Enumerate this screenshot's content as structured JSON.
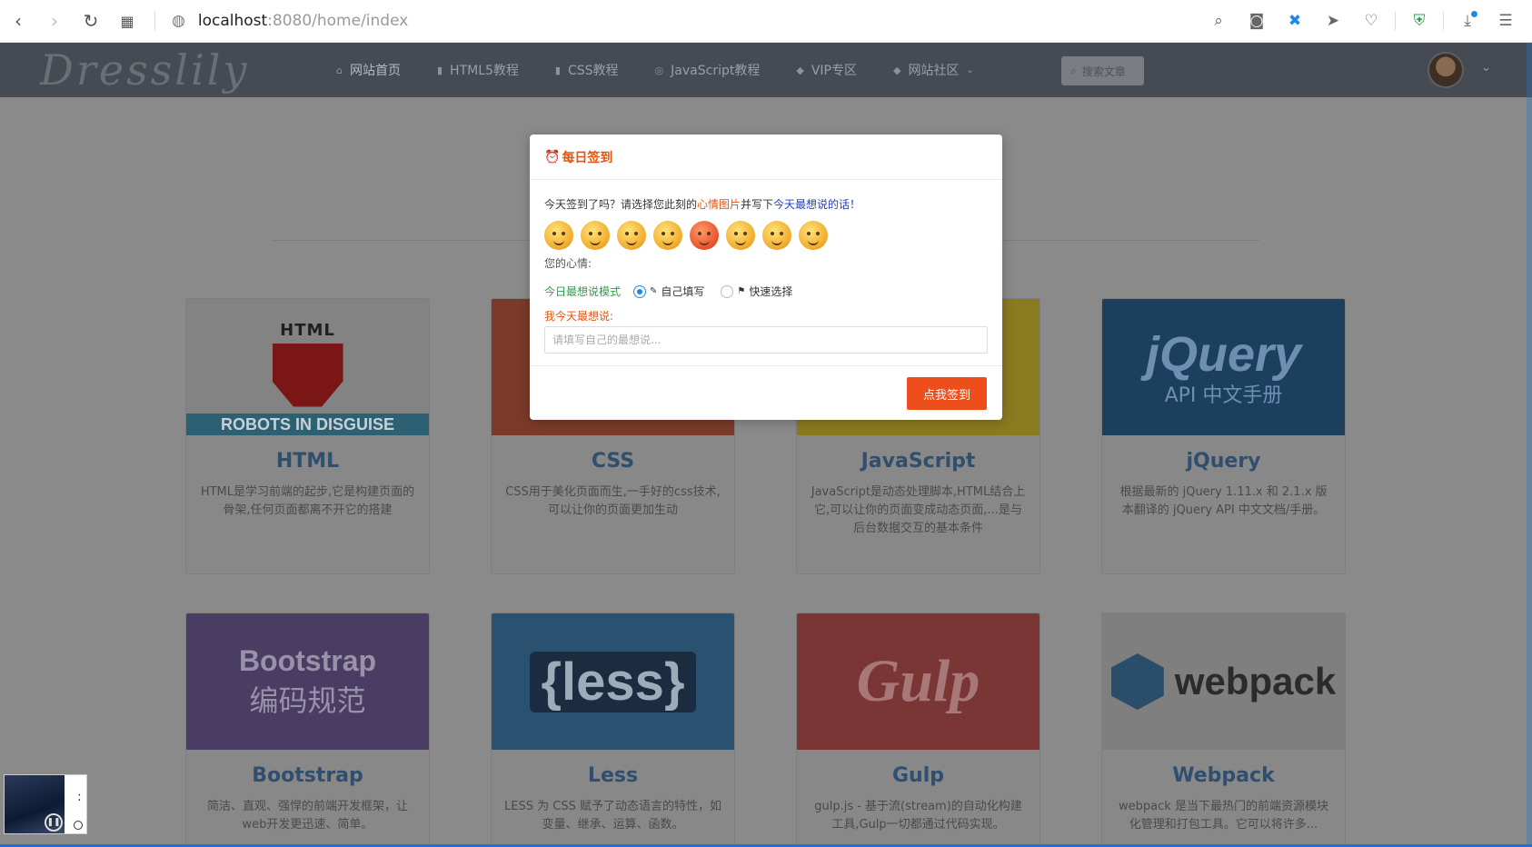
{
  "browser": {
    "url_host": "localhost",
    "url_path": ":8080/home/index"
  },
  "site": {
    "logo": "Dresslily",
    "nav": [
      {
        "label": "网站首页",
        "icon": "home-icon"
      },
      {
        "label": "HTML5教程",
        "icon": "html5-icon"
      },
      {
        "label": "CSS教程",
        "icon": "css3-icon"
      },
      {
        "label": "JavaScript教程",
        "icon": "js-icon"
      },
      {
        "label": "VIP专区",
        "icon": "vip-icon"
      },
      {
        "label": "网站社区",
        "icon": "community-icon"
      }
    ],
    "search_placeholder": "搜索文章"
  },
  "cards": [
    {
      "title": "HTML",
      "desc": "HTML是学习前端的起步,它是构建页面的骨架,任何页面都离不开它的搭建",
      "thumb_text_1": "HTML",
      "thumb_text_2": "ROBOTS IN DISGUISE"
    },
    {
      "title": "CSS",
      "desc": "CSS用于美化页面而生,一手好的css技术,可以让你的页面更加生动"
    },
    {
      "title": "JavaScript",
      "desc": "JavaScript是动态处理脚本,HTML结合上它,可以让你的页面变成动态页面,...是与后台数据交互的基本条件"
    },
    {
      "title": "jQuery",
      "desc": "根据最新的 jQuery 1.11.x 和 2.1.x 版本翻译的 jQuery API 中文文档/手册。",
      "thumb_text_1": "jQuery",
      "thumb_text_2": "API 中文手册"
    },
    {
      "title": "Bootstrap",
      "desc": "简洁、直观、强悍的前端开发框架，让web开发更迅速、简单。",
      "thumb_text_1": "Bootstrap",
      "thumb_text_2": "编码规范"
    },
    {
      "title": "Less",
      "desc": "LESS 为 CSS 赋予了动态语言的特性，如变量、继承、运算、函数。",
      "thumb_text_1": "{less}"
    },
    {
      "title": "Gulp",
      "desc": "gulp.js - 基于流(stream)的自动化构建工具,Gulp一切都通过代码实现。",
      "thumb_text_1": "Gulp"
    },
    {
      "title": "Webpack",
      "desc": "webpack 是当下最热门的前端资源模块化管理和打包工具。它可以将许多...",
      "thumb_text_1": "webpack"
    }
  ],
  "modal": {
    "title": "每日签到",
    "prompt_1": "今天签到了吗？请选择您此刻的",
    "prompt_hl1": "心情图片",
    "prompt_2": "并写下",
    "prompt_hl2": "今天最想说的话！",
    "emojis": [
      "happy",
      "crying",
      "sad",
      "sleepy",
      "angry",
      "sweat",
      "cool",
      "shy"
    ],
    "mood_label": "您的心情:",
    "mode_label": "今日最想说模式",
    "option_self": "自己填写",
    "option_quick": "快速选择",
    "selected_option": "自己填写",
    "say_label": "我今天最想说:",
    "say_placeholder": "请填写自己的最想说...",
    "submit_label": "点我签到"
  },
  "player": {
    "side_text": ":"
  }
}
